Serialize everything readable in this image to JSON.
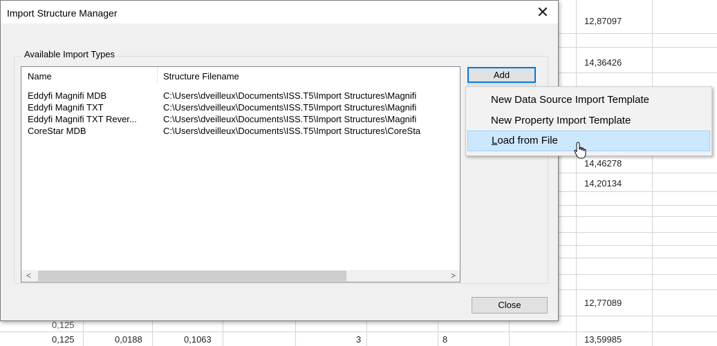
{
  "dialog": {
    "title": "Import Structure Manager",
    "close_glyph": "✕",
    "group_label": "Available Import Types",
    "columns": [
      "Name",
      "Structure Filename"
    ],
    "rows": [
      {
        "name": "Eddyfi Magnifi MDB",
        "file": "C:\\Users\\dveilleux\\Documents\\ISS.T5\\Import Structures\\Magnifi"
      },
      {
        "name": "Eddyfi Magnifi TXT",
        "file": "C:\\Users\\dveilleux\\Documents\\ISS.T5\\Import Structures\\Magnifi"
      },
      {
        "name": "Eddyfi Magnifi TXT Rever...",
        "file": "C:\\Users\\dveilleux\\Documents\\ISS.T5\\Import Structures\\Magnifi"
      },
      {
        "name": "CoreStar MDB",
        "file": "C:\\Users\\dveilleux\\Documents\\ISS.T5\\Import Structures\\CoreSta"
      }
    ],
    "scroll_left": "<",
    "scroll_right": ">",
    "add_label": "Add",
    "close_label": "Close"
  },
  "menu": {
    "items": [
      {
        "label": "New Data Source Import Template"
      },
      {
        "label": "New Property Import Template"
      },
      {
        "label": "Load from File",
        "accelerator": "L",
        "rest": "oad from File"
      }
    ]
  },
  "sheet": {
    "right_values": [
      "12,87097",
      "14,36426",
      "14,46278",
      "14,20134",
      "12,77089",
      "13,59985"
    ],
    "bottom_row": [
      "0,125",
      "0,0188",
      "0,1063",
      "3",
      "8"
    ],
    "partial_cell": "0,125"
  },
  "colors": {
    "accent": "#0078d7",
    "menu_highlight": "#cce8ff"
  }
}
